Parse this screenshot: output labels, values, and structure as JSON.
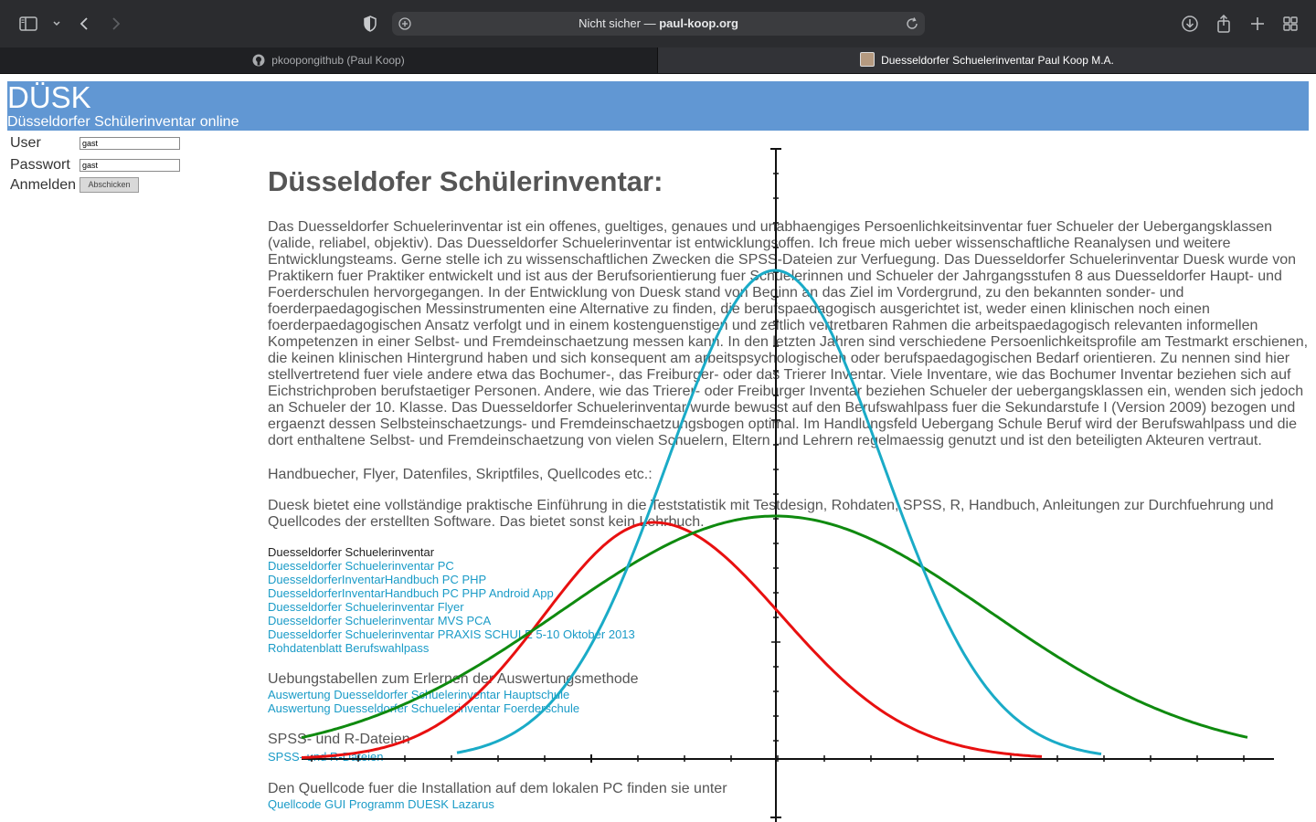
{
  "browser": {
    "address_insecure": "Nicht sicher —",
    "address_domain": "paul-koop.org",
    "tabs": [
      {
        "label": "pkoopongithub (Paul Koop)",
        "active": false
      },
      {
        "label": "Duesseldorfer Schuelerinventar Paul Koop M.A.",
        "active": true
      }
    ]
  },
  "banner": {
    "title": "DÜSK",
    "subtitle": "Düsseldorfer Schülerinventar online",
    "color": "#6197d3"
  },
  "login": {
    "user_label": "User",
    "user_value": "gast",
    "password_label": "Passwort",
    "password_value": "gast",
    "submit_label": "Anmelden",
    "submit_button": "Abschicken"
  },
  "content": {
    "heading": "Düsseldofer Schülerinventar:",
    "intro": "Das Duesseldorfer Schuelerinventar ist ein offenes, gueltiges, genaues und unabhaengiges Persoenlichkeitsinventar fuer Schueler der Uebergangsklassen (valide, reliabel, objektiv). Das Duesseldorfer Schuelerinventar ist entwicklungsoffen. Ich freue mich ueber wissenschaftliche Reanalysen und weitere Entwicklungsteams. Gerne stelle ich zu wissenschaftlichen Zwecken die SPSS-Dateien zur Verfuegung. Das Duesseldorfer Schuelerinventar Duesk wurde von Praktikern fuer Praktiker entwickelt und ist aus der Berufsorientierung fuer Schuelerinnen und Schueler der Jahrgangsstufen 8 aus Duesseldorfer Haupt- und Foerderschulen hervorgegangen. In der Entwicklung von Duesk stand von Beginn an das Ziel im Vordergrund, zu den bekannten sonder- und foerderpaedagogischen Messinstrumenten eine Alternative zu finden, die berufspaedagogisch ausgerichtet ist, weder einen klinischen noch einen foerderpaedagogischen Ansatz verfolgt und in einem kostenguenstigen und zeitlich vertretbaren Rahmen die arbeitspaedagogisch relevanten informellen Kompetenzen in einer Selbst- und Fremdeinschaetzung messen kann. In den letzten Jahren sind verschiedene Persoenlichkeitsprofile am Testmarkt erschienen, die keinen klinischen Hintergrund haben und sich konsequent am arbeitspsychologischen oder berufspaedagogischen Bedarf orientieren. Zu nennen sind hier stellvertretend fuer viele andere etwa das Bochumer-, das Freiburger- oder das Trierer Inventar. Viele Inventare, wie das Bochumer Inventar beziehen sich auf Eichstrichproben berufstaetiger Personen. Andere, wie das Trierer- oder Freiburger Inventar beziehen Schueler der uebergangsklassen ein, wenden sich jedoch an Schueler der 10. Klasse. Das Duesseldorfer Schuelerinventar wurde bewusst auf den Berufswahlpass fuer die Sekundarstufe I (Version 2009) bezogen und ergaenzt dessen Selbsteinschaetzungs- und Fremdeinschaetzungsbogen optimal. Im Handlungsfeld Uebergang Schule Beruf wird der Berufswahlpass und die dort enthaltene Selbst- und Fremdeinschaetzung von vielen Schuelern, Eltern und Lehrern regelmaessig genutzt und ist den beteiligten Akteuren vertraut.",
    "handbooks": "Handbuecher, Flyer, Datenfiles, Skriptfiles, Quellcodes etc.:",
    "duesk_offer": "Duesk bietet eine vollständige praktische Einführung in die Teststatistik mit Testdesign, Rohdaten, SPSS, R, Handbuch, Anleitungen zur Durchfuehrung und Quellcodes der erstellten Software. Das bietet sonst kein Lehrbuch.",
    "links_main": [
      "Duesseldorfer Schuelerinventar",
      "Duesseldorfer Schuelerinventar PC",
      "DuesseldorferInventarHandbuch PC PHP",
      "DuesseldorferInventarHandbuch PC PHP Android App",
      "Duesseldorfer Schuelerinventar Flyer",
      "Duesseldorfer Schuelerinventar MVS PCA",
      "Duesseldorfer Schuelerinventar PRAXIS SCHULE 5-10 Oktober 2013",
      "Rohdatenblatt Berufswahlpass"
    ],
    "exercise_heading": "Uebungstabellen zum Erlernen der Auswertungsmethode",
    "exercise_links": [
      "Auswertung Duesseldorfer Schuelerinventar Hauptschule",
      "Auswertung Duesseldorfer Schuelerinventar Foerderschule"
    ],
    "spss_heading": "SPSS- und R-Dateien",
    "spss_link": "SPSS- und R-Dateien",
    "source_heading": "Den Quellcode fuer die Installation auf dem lokalen PC finden sie unter",
    "source_link": "Quellcode GUI Programm DUESK Lazarus"
  },
  "curves": {
    "colors": {
      "red": "#e81010",
      "green": "#0f8a0f",
      "cyan": "#1aabc7"
    },
    "axis_color": "#111111"
  }
}
